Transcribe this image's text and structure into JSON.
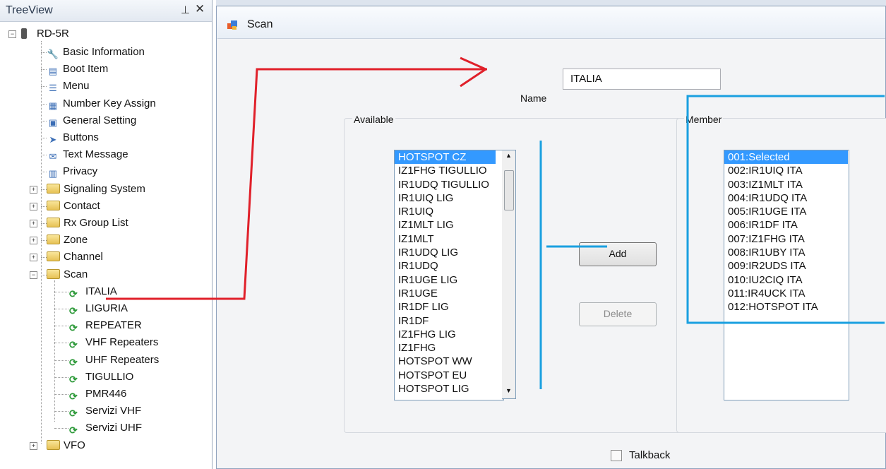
{
  "tree": {
    "title": "TreeView",
    "pin_glyph": "⊥",
    "close_glyph": "✕",
    "root": "RD-5R",
    "items": [
      {
        "label": "Basic Information",
        "icon": "wrench-icon"
      },
      {
        "label": "Boot Item",
        "icon": "document-icon"
      },
      {
        "label": "Menu",
        "icon": "menu-list-icon"
      },
      {
        "label": "Number Key Assign",
        "icon": "keypad-icon"
      },
      {
        "label": "General Setting",
        "icon": "settings-icon"
      },
      {
        "label": "Buttons",
        "icon": "cursor-icon"
      },
      {
        "label": "Text Message",
        "icon": "envelope-icon"
      },
      {
        "label": "Privacy",
        "icon": "privacy-icon"
      },
      {
        "label": "Signaling System",
        "icon": "folder-icon"
      },
      {
        "label": "Contact",
        "icon": "folder-icon"
      },
      {
        "label": "Rx Group List",
        "icon": "folder-icon"
      },
      {
        "label": "Zone",
        "icon": "folder-icon"
      },
      {
        "label": "Channel",
        "icon": "folder-icon"
      },
      {
        "label": "Scan",
        "icon": "folder-icon"
      }
    ],
    "scan_children": [
      "ITALIA",
      "LIGURIA",
      "REPEATER",
      "VHF Repeaters",
      "UHF Repeaters",
      "TIGULLIO",
      "PMR446",
      "Servizi VHF",
      "Servizi UHF"
    ],
    "last": "VFO"
  },
  "doc": {
    "tab_title": "Scan",
    "name_label": "Name",
    "name_value": "ITALIA",
    "available_label": "Available",
    "member_label": "Member",
    "available_items": [
      "HOTSPOT CZ",
      "IZ1FHG TIGULLIO",
      "IR1UDQ TIGULLIO",
      "IR1UIQ LIG",
      "IR1UIQ",
      "IZ1MLT LIG",
      "IZ1MLT",
      "IR1UDQ LIG",
      "IR1UDQ",
      "IR1UGE LIG",
      "IR1UGE",
      "IR1DF LIG",
      "IR1DF",
      "IZ1FHG LIG",
      "IZ1FHG",
      "HOTSPOT WW",
      "HOTSPOT EU",
      "HOTSPOT LIG"
    ],
    "member_items": [
      "001:Selected",
      "002:IR1UIQ ITA",
      "003:IZ1MLT ITA",
      "004:IR1UDQ ITA",
      "005:IR1UGE ITA",
      "006:IR1DF ITA",
      "007:IZ1FHG ITA",
      "008:IR1UBY ITA",
      "009:IR2UDS ITA",
      "010:IU2CIQ ITA",
      "011:IR4UCK ITA",
      "012:HOTSPOT ITA"
    ],
    "add_label": "Add",
    "delete_label": "Delete",
    "talkback_label": "Talkback",
    "talkback_checked": false
  },
  "colors": {
    "annotation_red": "#e0202a",
    "annotation_blue": "#1aa0e0",
    "selection": "#3399ff"
  }
}
